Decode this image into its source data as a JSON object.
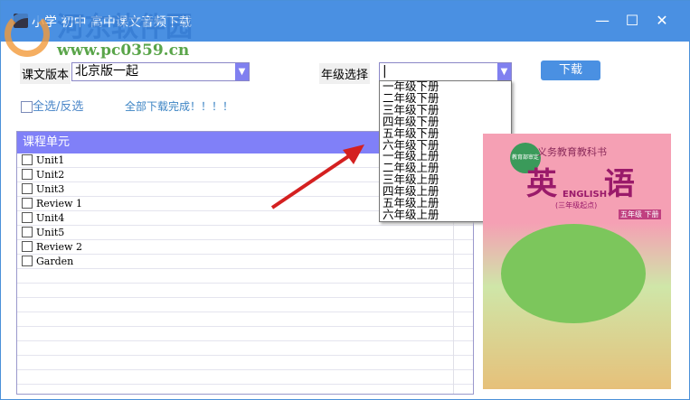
{
  "window": {
    "title": "小学 初中 高中课文音频下载",
    "watermark": "河东软件园",
    "watermark_url": "www.pc0359.cn",
    "minimize": "—",
    "maximize": "☐",
    "close": "✕"
  },
  "form": {
    "version_label": "课文版本",
    "version_value": "北京版一起",
    "grade_label": "年级选择",
    "grade_value": "|",
    "download_label": "下载",
    "select_all_label": "全选/反选",
    "status": "全部下载完成！！！！"
  },
  "grade_options": [
    "一年级下册",
    "二年级下册",
    "三年级下册",
    "四年级下册",
    "五年级下册",
    "六年级下册",
    "一年级上册",
    "二年级上册",
    "三年级上册",
    "四年级上册",
    "五年级上册",
    "六年级上册"
  ],
  "list": {
    "header": "课程单元",
    "items": [
      "Unit1",
      "Unit2",
      "Unit3",
      "Review 1",
      "Unit4",
      "Unit5",
      "Review 2",
      "Garden"
    ]
  },
  "cover": {
    "series": "义务教育教科书",
    "title": "英 语",
    "subtitle": "ENGLISH",
    "note": "(三年级起点)",
    "grade": "五年级 下册",
    "seal": "教育部审定"
  }
}
